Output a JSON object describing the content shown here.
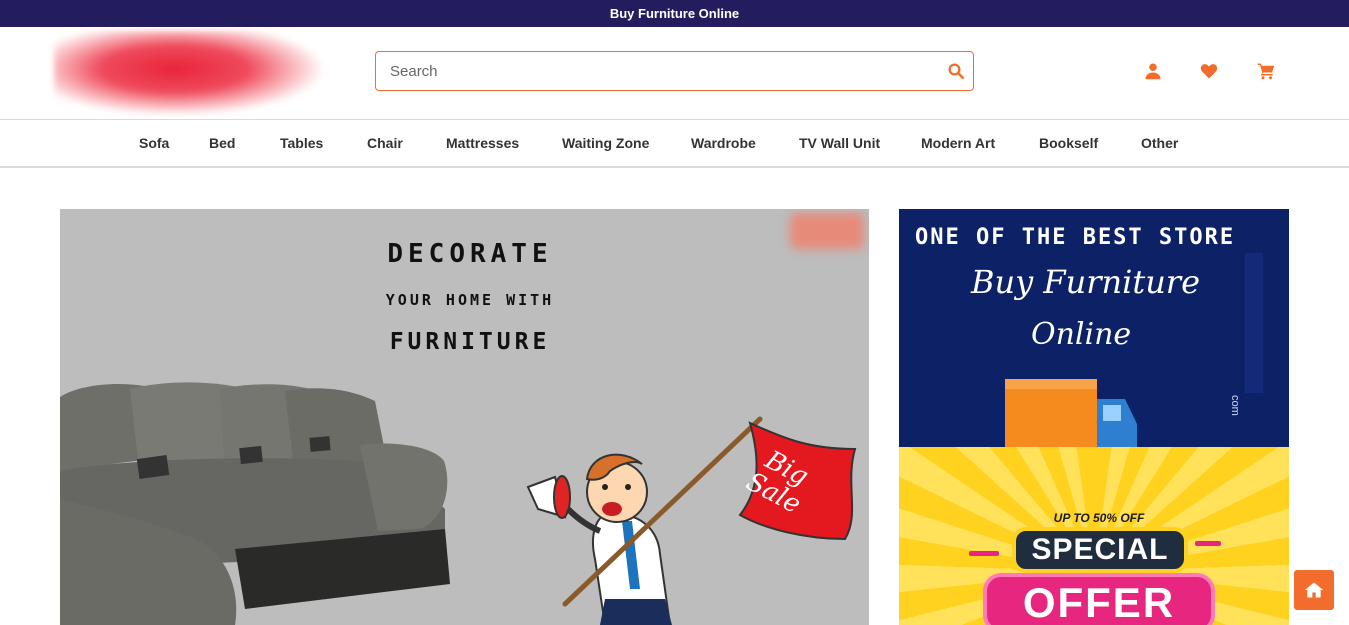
{
  "topbar": {
    "text": "Buy Furniture Online"
  },
  "search": {
    "placeholder": "Search"
  },
  "nav": {
    "items": [
      "Sofa",
      "Bed",
      "Tables",
      "Chair",
      "Mattresses",
      "Waiting Zone",
      "Wardrobe",
      "TV Wall Unit",
      "Modern Art",
      "Bookself",
      "Other"
    ]
  },
  "hero": {
    "line1": "DECORATE",
    "line2": "YOUR HOME WITH",
    "line3": "FURNITURE",
    "flag_line1": "Big",
    "flag_line2": "Sale"
  },
  "side_banner_top": {
    "line1": "ONE OF THE BEST STORE",
    "line2": "Buy Furniture",
    "line3": "Online",
    "vertical": "com"
  },
  "side_banner_bottom": {
    "upto": "UP TO 50% OFF",
    "special": "SPECIAL",
    "offer": "OFFER"
  },
  "colors": {
    "accent": "#f26c2e",
    "topbar": "#231d5e",
    "side_top_bg": "#0d2167",
    "offer_pink": "#e6267f"
  },
  "icons": {
    "search": "search-icon",
    "account": "user-icon",
    "wishlist": "heart-icon",
    "cart": "cart-icon",
    "home": "home-icon"
  }
}
